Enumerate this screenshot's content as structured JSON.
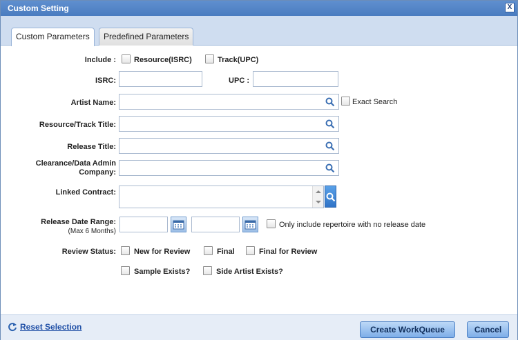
{
  "dialog": {
    "title": "Custom Setting",
    "close_label": "X"
  },
  "tabs": [
    {
      "label": "Custom Parameters",
      "active": true
    },
    {
      "label": "Predefined Parameters",
      "active": false
    }
  ],
  "form": {
    "include": {
      "label": "Include :",
      "options": [
        "Resource(ISRC)",
        "Track(UPC)"
      ]
    },
    "isrc": {
      "label": "ISRC:",
      "value": ""
    },
    "upc": {
      "label": "UPC :",
      "value": ""
    },
    "artist_name": {
      "label": "Artist Name:",
      "value": "",
      "exact_search_label": "Exact Search"
    },
    "resource_track_title": {
      "label": "Resource/Track Title:",
      "value": ""
    },
    "release_title": {
      "label": "Release Title:",
      "value": ""
    },
    "clearance_company": {
      "label_line1": "Clearance/Data Admin",
      "label_line2": "Company:",
      "value": ""
    },
    "linked_contract": {
      "label": "Linked Contract:",
      "value": ""
    },
    "release_date_range": {
      "label": "Release Date Range:",
      "sublabel": "(Max 6 Months)",
      "from": "",
      "to": "",
      "no_release_label": "Only include repertoire with no release date"
    },
    "review_status": {
      "label": "Review Status:",
      "options": [
        "New for Review",
        "Final",
        "Final for Review"
      ]
    },
    "extra_options": [
      "Sample Exists?",
      "Side Artist Exists?"
    ]
  },
  "footer": {
    "reset_label": "Reset Selection",
    "create_label": "Create WorkQueue",
    "cancel_label": "Cancel"
  }
}
